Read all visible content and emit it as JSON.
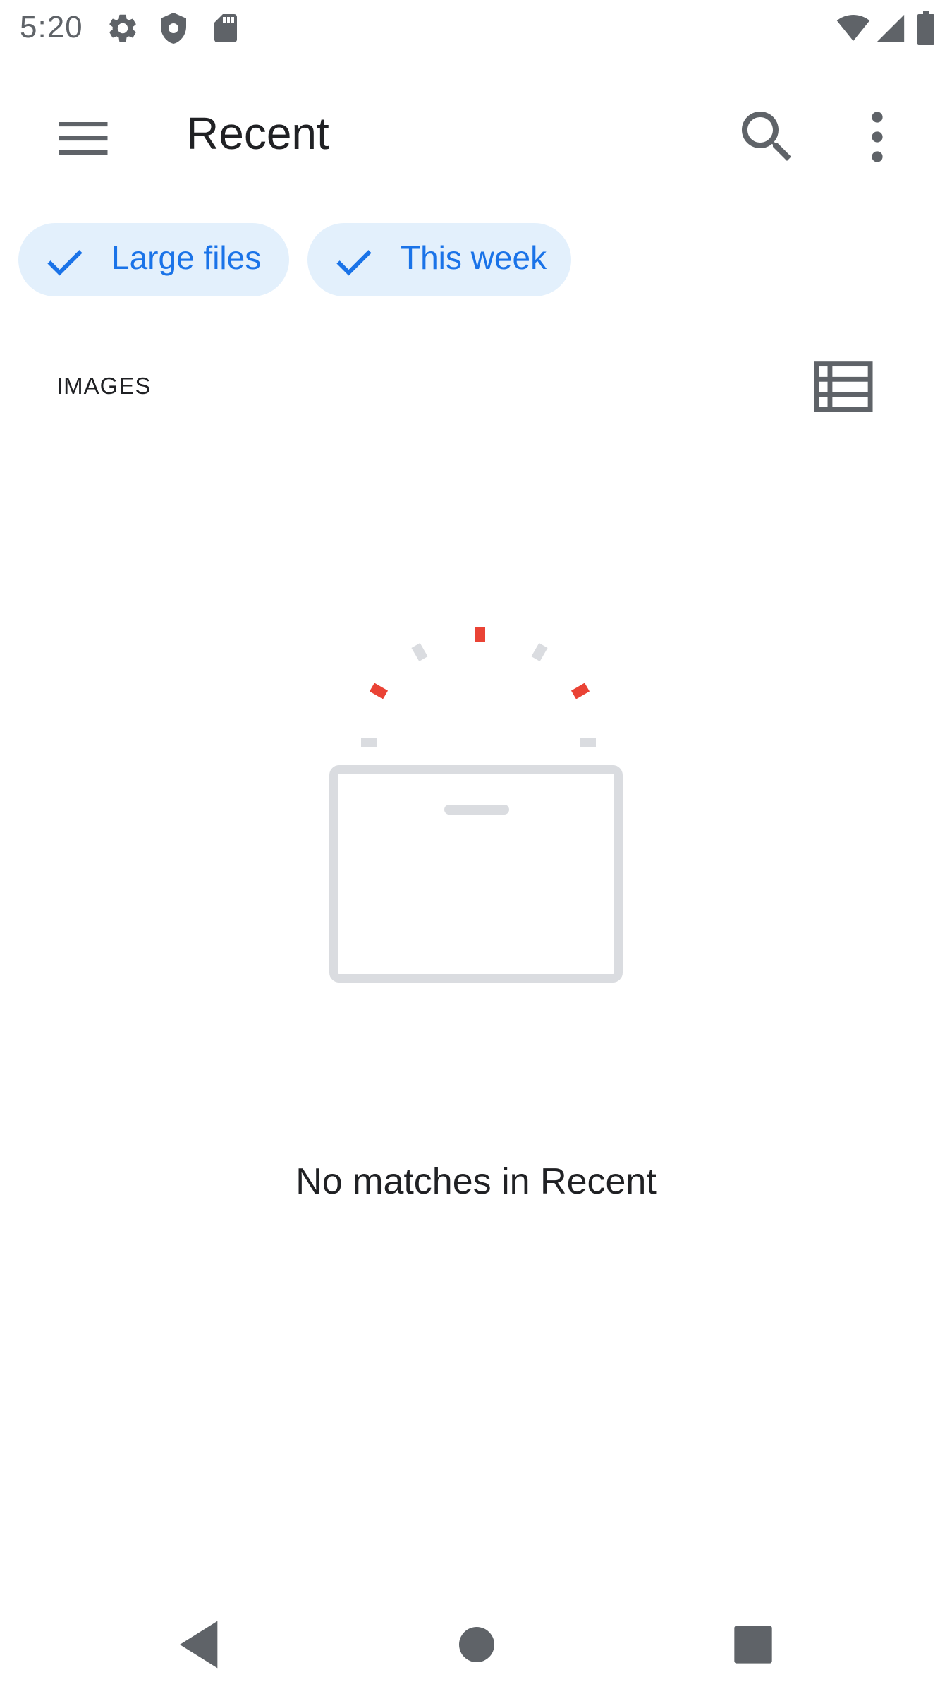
{
  "status_bar": {
    "time": "5:20",
    "icons": [
      "settings-icon",
      "shield-icon",
      "sd-card-icon",
      "wifi-icon",
      "cell-signal-icon",
      "battery-icon"
    ]
  },
  "app_bar": {
    "title": "Recent",
    "icons": [
      "menu-icon",
      "search-icon",
      "more-vert-icon"
    ]
  },
  "filters": {
    "chips": [
      {
        "label": "Large files",
        "selected": true
      },
      {
        "label": "This week",
        "selected": true
      }
    ]
  },
  "section": {
    "label": "IMAGES",
    "view_icon": "list-view-icon"
  },
  "empty_state": {
    "message": "No matches in Recent",
    "illustration": "empty-box-illustration"
  },
  "nav_bar": {
    "icons": [
      "back-icon",
      "home-icon",
      "recents-icon"
    ]
  },
  "colors": {
    "accent": "#1a73e8",
    "chip_background": "#e3f0fc",
    "illustration_gray": "#dadce0",
    "illustration_red": "#ea4335",
    "icon_gray": "#5f6368"
  }
}
